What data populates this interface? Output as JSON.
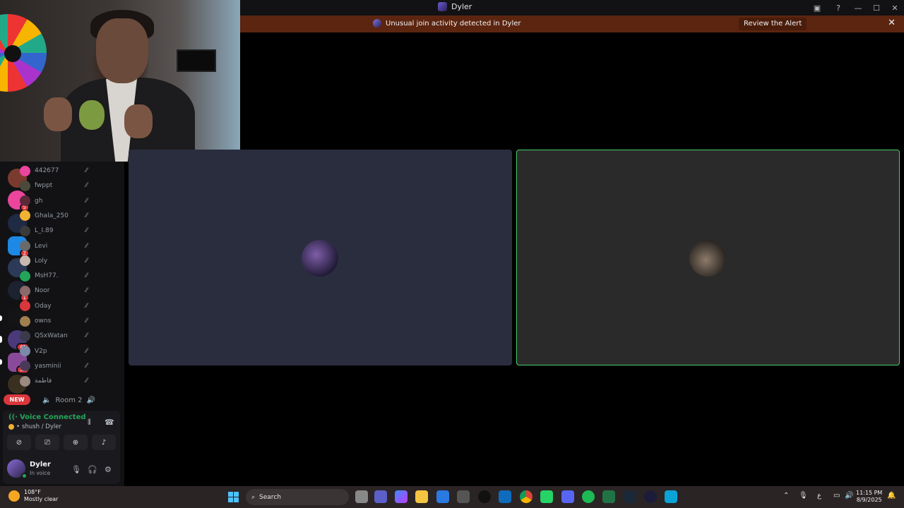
{
  "window": {
    "title": "Dyler"
  },
  "alert": {
    "text": "Unusual join activity detected in Dyler",
    "action_label": "Review the Alert"
  },
  "servers": [
    {
      "badge": "5",
      "color": "#7a3b2e"
    },
    {
      "badge": "5",
      "color": "#eb459e"
    },
    {
      "badge": "5",
      "color": "#1f2a44"
    },
    {
      "badge": "2",
      "color": "#1e88e5"
    },
    {
      "badge": "3",
      "color": "#2c3a58"
    },
    {
      "badge": "1",
      "color": "#1c2230"
    },
    {
      "badge": "",
      "color": "#141416"
    },
    {
      "badge": "41",
      "color": "#4a3a7a"
    },
    {
      "badge": "32",
      "color": "#8a4a9a"
    },
    {
      "badge": "",
      "color": "#3a3020"
    }
  ],
  "new_label": "NEW",
  "members": [
    {
      "name": "442677",
      "color": "#eb459e"
    },
    {
      "name": "fwppt",
      "color": "#4a4a3a"
    },
    {
      "name": "gh",
      "color": "#5a2a3a"
    },
    {
      "name": "Ghala_250",
      "color": "#f0b232"
    },
    {
      "name": "L_I.89",
      "color": "#3a3a3a"
    },
    {
      "name": "Levi",
      "color": "#6a6a6a"
    },
    {
      "name": "Loly",
      "color": "#c9b8b0"
    },
    {
      "name": "MsH77.",
      "color": "#23a559"
    },
    {
      "name": "Noor",
      "color": "#8a6a6a"
    },
    {
      "name": "Oday",
      "color": "#da373c"
    },
    {
      "name": "owns",
      "color": "#a08050"
    },
    {
      "name": "QSxWatan",
      "color": "#3a3a4a"
    },
    {
      "name": "V2p",
      "color": "#7a8aa8"
    },
    {
      "name": "yasminii",
      "color": "#4a3a5a"
    },
    {
      "name": "فاطمة",
      "color": "#9a8a80"
    }
  ],
  "room": {
    "label": "Room 2"
  },
  "voice": {
    "status": "Voice Connected",
    "channel": "shush / Dyler"
  },
  "user": {
    "name": "Dyler",
    "status": "In voice"
  },
  "taskbar": {
    "temperature": "108°F",
    "weather": "Mostly clear",
    "search_placeholder": "Search",
    "time": "11:15 PM",
    "date": "8/9/2025",
    "lang": "ع"
  },
  "icons": {
    "mute": "slashed-mic-icon",
    "deafen": "headphones-icon",
    "settings": "gear-icon",
    "disconnect": "phone-hangup-icon"
  }
}
